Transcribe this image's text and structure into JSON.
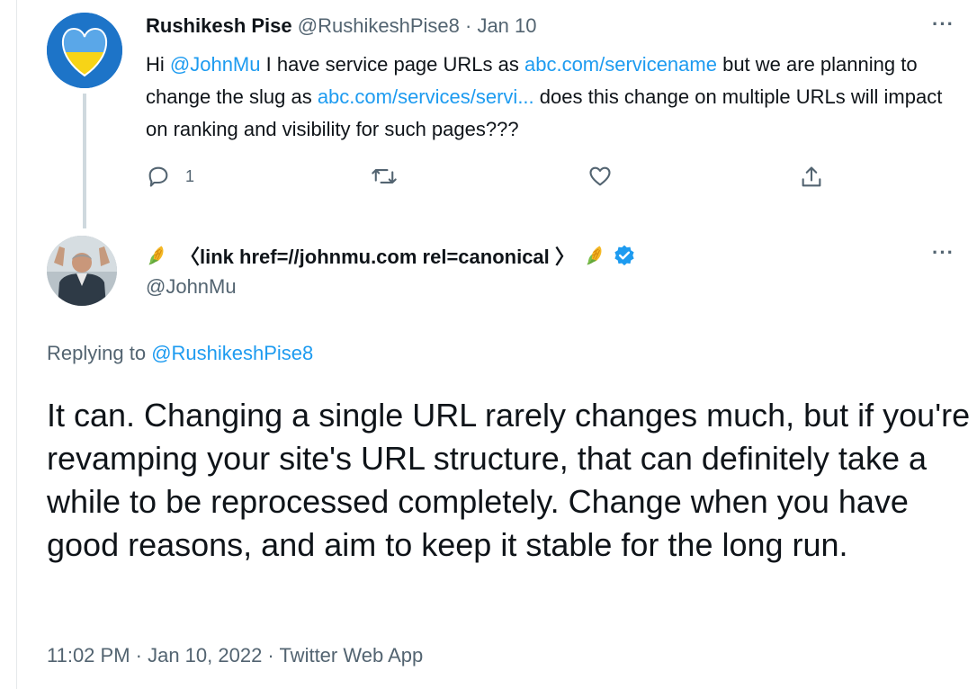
{
  "original_tweet": {
    "display_name": "Rushikesh Pise",
    "handle": "@RushikeshPise8",
    "date": "Jan 10",
    "separator": "·",
    "more_label": "···",
    "text_parts": {
      "p1": "Hi ",
      "mention": "@JohnMu",
      "p2": " I have service page URLs as ",
      "link1": "abc.com/servicename",
      "p3": " but we are planning to change the slug as ",
      "link2": "abc.com/services/servi...",
      "p4": " does this change on multiple URLs will impact on ranking and visibility for such pages???"
    },
    "reply_count": "1"
  },
  "reply_tweet": {
    "display_name": "〈link href=//johnmu.com rel=canonical 〉",
    "handle": "@JohnMu",
    "more_label": "···",
    "replying_prefix": "Replying to ",
    "replying_to": "@RushikeshPise8",
    "text": "It can. Changing a single URL rarely changes much, but if you're revamping your site's URL structure, that can definitely take a while to be reprocessed completely. Change when you have good reasons, and aim to keep it stable for the long run.",
    "timestamp": "11:02 PM · Jan 10, 2022 · Twitter Web App"
  },
  "icons": {
    "reply": "reply-icon",
    "retweet": "retweet-icon",
    "like": "like-icon",
    "share": "share-icon",
    "verified": "verified-badge-icon",
    "corn": "corn-emoji-icon"
  },
  "colors": {
    "link": "#1d9bf0",
    "muted": "#536471",
    "text": "#0f1419",
    "heart_blue": "#1d74c8",
    "heart_yellow": "#f7d417"
  }
}
